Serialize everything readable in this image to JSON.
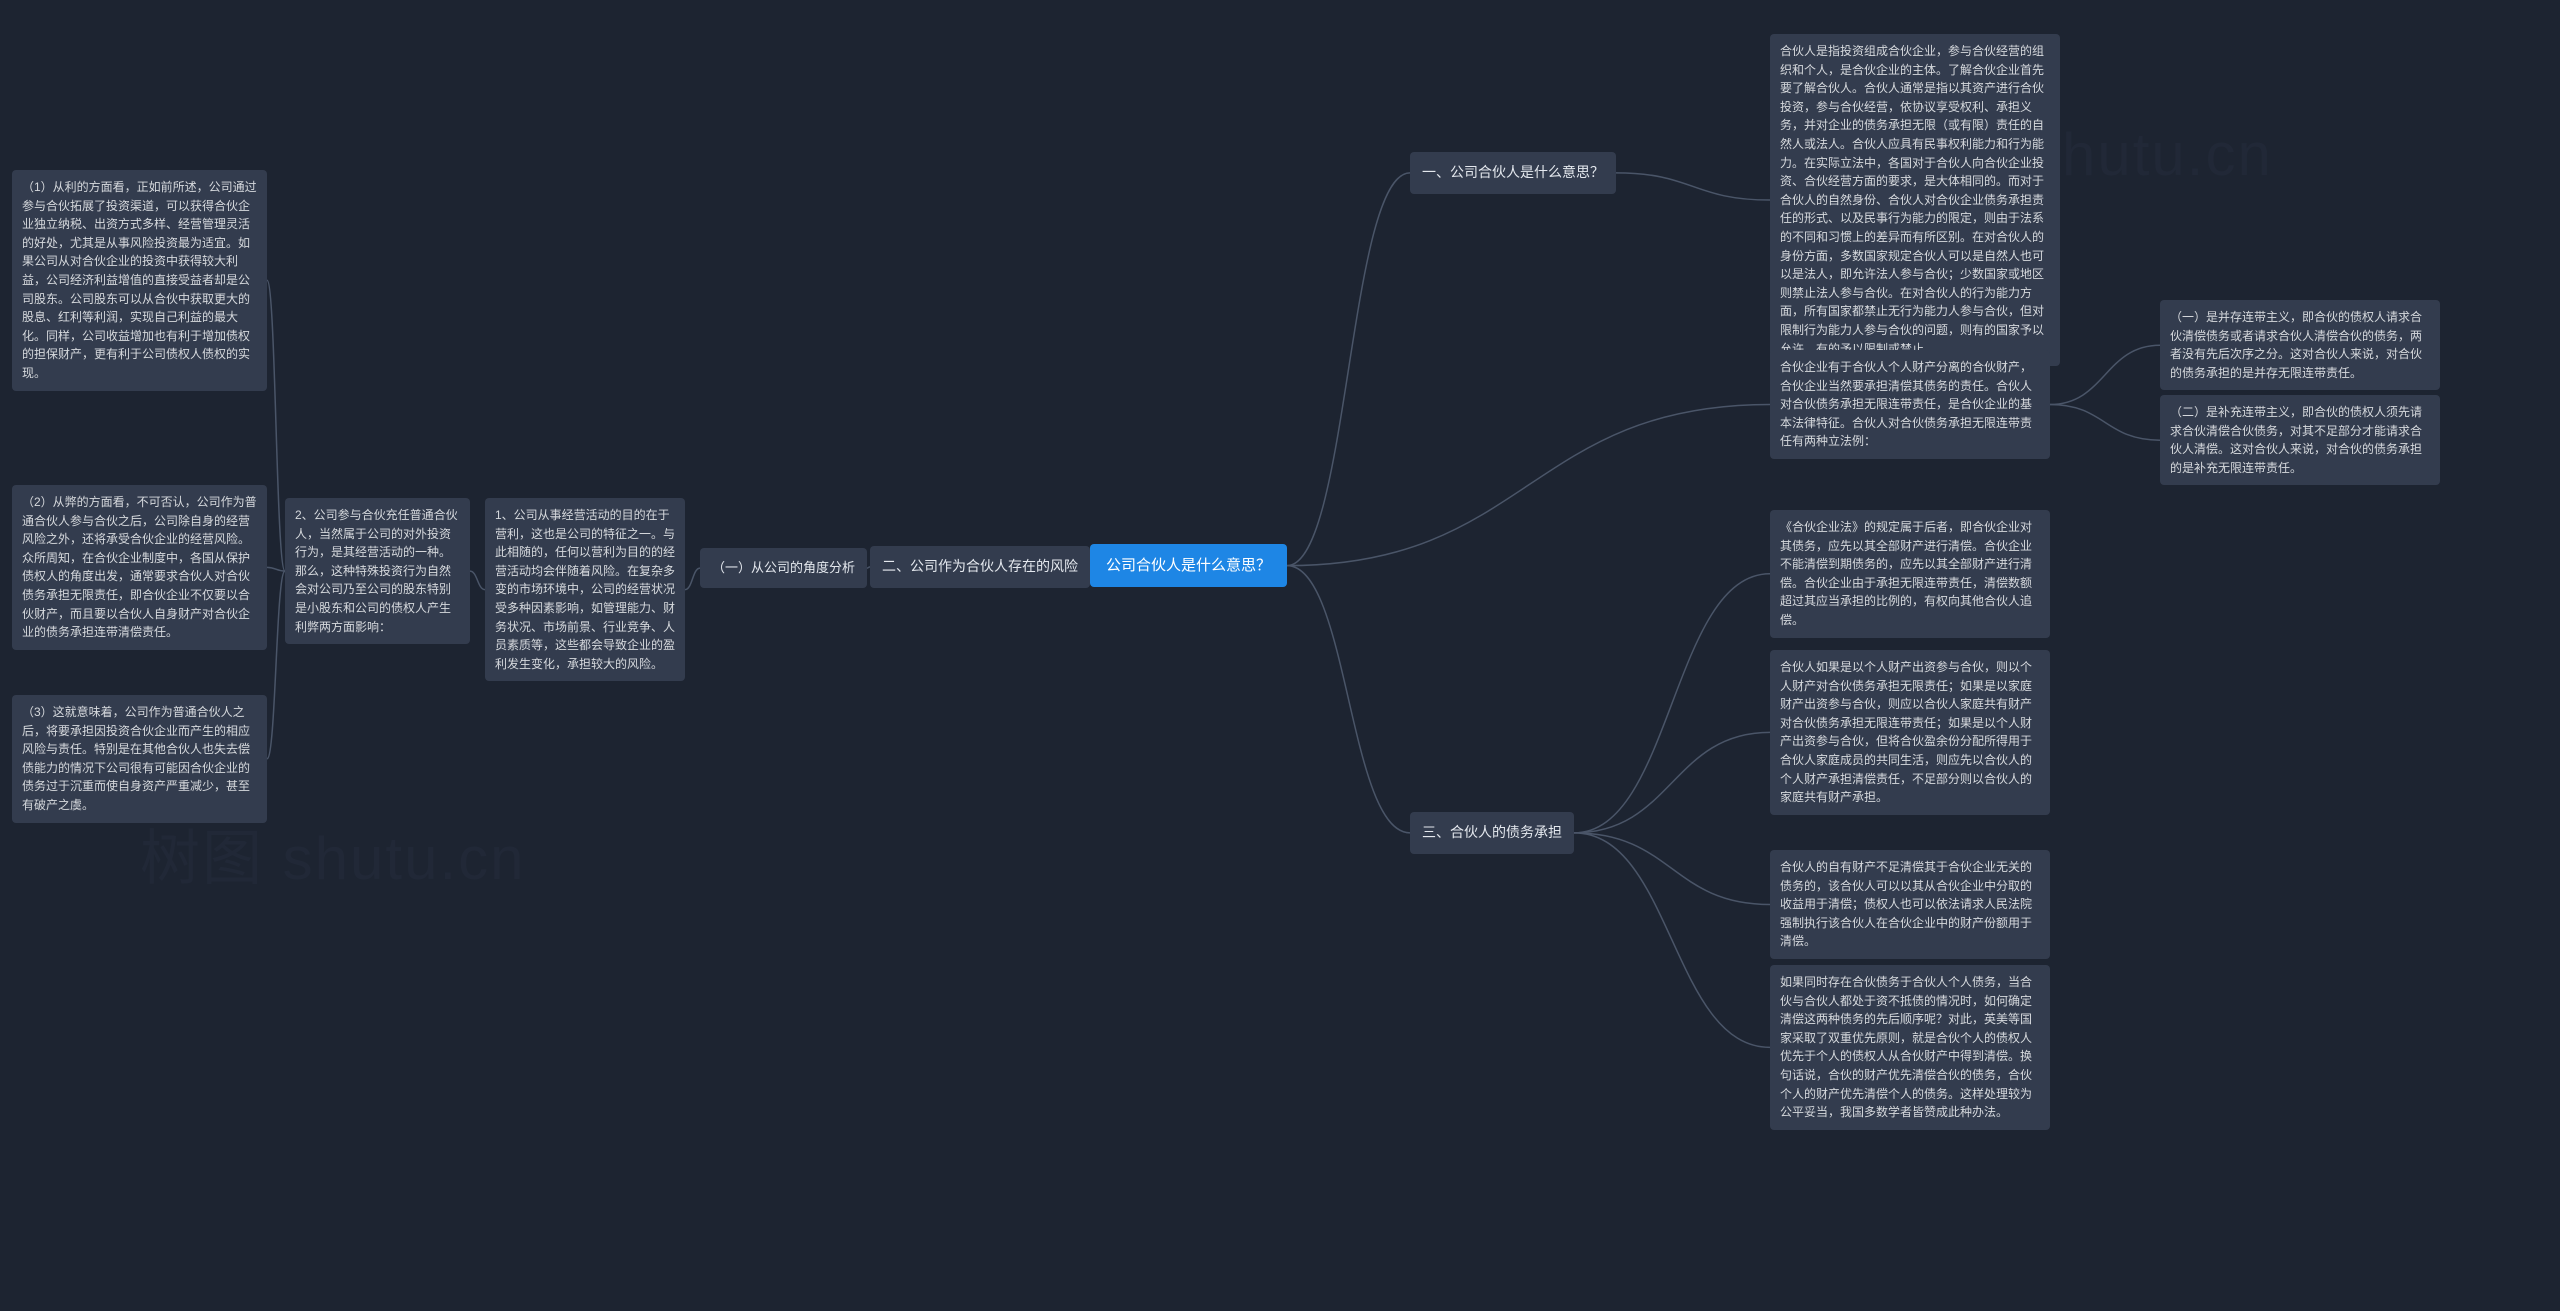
{
  "root": "公司合伙人是什么意思？",
  "watermark1": "shutu.cn",
  "watermark2": "树图 shutu.cn",
  "r1": {
    "title": "一、公司合伙人是什么意思？",
    "text": "合伙人是指投资组成合伙企业，参与合伙经营的组织和个人，是合伙企业的主体。了解合伙企业首先要了解合伙人。合伙人通常是指以其资产进行合伙投资，参与合伙经营，依协议享受权利、承担义务，并对企业的债务承担无限（或有限）责任的自然人或法人。合伙人应具有民事权利能力和行为能力。在实际立法中，各国对于合伙人向合伙企业投资、合伙经营方面的要求，是大体相同的。而对于合伙人的自然身份、合伙人对合伙企业债务承担责任的形式、以及民事行为能力的限定，则由于法系的不同和习惯上的差异而有所区别。在对合伙人的身份方面，多数国家规定合伙人可以是自然人也可以是法人，即允许法人参与合伙；少数国家或地区则禁止法人参与合伙。在对合伙人的行为能力方面，所有国家都禁止无行为能力人参与合伙，但对限制行为能力人参与合伙的问题，则有的国家予以允许，有的予以限制或禁止。"
  },
  "r2": {
    "leadin": "合伙企业有于合伙人个人财产分离的合伙财产，合伙企业当然要承担清偿其债务的责任。合伙人对合伙债务承担无限连带责任，是合伙企业的基本法律特征。合伙人对合伙债务承担无限连带责任有两种立法例：",
    "sub1": "（一）是并存连带主义，即合伙的债权人请求合伙清偿债务或者请求合伙人清偿合伙的债务，两者没有先后次序之分。这对合伙人来说，对合伙的债务承担的是并存无限连带责任。",
    "sub2": "（二）是补充连带主义，即合伙的债权人须先请求合伙清偿合伙债务，对其不足部分才能请求合伙人清偿。这对合伙人来说，对合伙的债务承担的是补充无限连带责任。"
  },
  "r3": {
    "title": "三、合伙人的债务承担",
    "p1": "《合伙企业法》的规定属于后者，即合伙企业对其债务，应先以其全部财产进行清偿。合伙企业不能清偿到期债务的，应先以其全部财产进行清偿。合伙企业由于承担无限连带责任，清偿数额超过其应当承担的比例的，有权向其他合伙人追偿。",
    "p2": "合伙人如果是以个人财产出资参与合伙，则以个人财产对合伙债务承担无限责任；如果是以家庭财产出资参与合伙，则应以合伙人家庭共有财产对合伙债务承担无限连带责任；如果是以个人财产出资参与合伙，但将合伙盈余份分配所得用于合伙人家庭成员的共同生活，则应先以合伙人的个人财产承担清偿责任，不足部分则以合伙人的家庭共有财产承担。",
    "p3": "合伙人的自有财产不足清偿其于合伙企业无关的债务的，该合伙人可以以其从合伙企业中分取的收益用于清偿；债权人也可以依法请求人民法院强制执行该合伙人在合伙企业中的财产份额用于清偿。",
    "p4": "如果同时存在合伙债务于合伙人个人债务，当合伙与合伙人都处于资不抵债的情况时，如何确定清偿这两种债务的先后顺序呢？对此，英美等国家采取了双重优先原则，就是合伙个人的债权人优先于个人的债权人从合伙财产中得到清偿。换句话说，合伙的财产优先清偿合伙的债务，合伙个人的财产优先清偿个人的债务。这样处理较为公平妥当，我国多数学者皆赞成此种办法。"
  },
  "l1": {
    "title": "二、公司作为合伙人存在的风险",
    "sub_title": "（一）从公司的角度分析",
    "g1": "1、公司从事经营活动的目的在于营利，这也是公司的特征之一。与此相随的，任何以营利为目的的经营活动均会伴随着风险。在复杂多变的市场环境中，公司的经营状况受多种因素影响，如管理能力、财务状况、市场前景、行业竞争、人员素质等，这些都会导致企业的盈利发生变化，承担较大的风险。",
    "g2": "2、公司参与合伙充任普通合伙人，当然属于公司的对外投资行为，是其经营活动的一种。那么，这种特殊投资行为自然会对公司乃至公司的股东特别是小股东和公司的债权人产生利弊两方面影响：",
    "leaf1": "（1）从利的方面看，正如前所述，公司通过参与合伙拓展了投资渠道，可以获得合伙企业独立纳税、出资方式多样、经营管理灵活的好处，尤其是从事风险投资最为适宜。如果公司从对合伙企业的投资中获得较大利益，公司经济利益增值的直接受益者却是公司股东。公司股东可以从合伙中获取更大的股息、红利等利润，实现自己利益的最大化。同样，公司收益增加也有利于增加债权的担保财产，更有利于公司债权人债权的实现。",
    "leaf2": "（2）从弊的方面看，不可否认，公司作为普通合伙人参与合伙之后，公司除自身的经营风险之外，还将承受合伙企业的经营风险。众所周知，在合伙企业制度中，各国从保护债权人的角度出发，通常要求合伙人对合伙债务承担无限责任，即合伙企业不仅要以合伙财产，而且要以合伙人自身财产对合伙企业的债务承担连带清偿责任。",
    "leaf3": "（3）这就意味着，公司作为普通合伙人之后，将要承担因投资合伙企业而产生的相应风险与责任。特别是在其他合伙人也失去偿债能力的情况下公司很有可能因合伙企业的债务过于沉重而使自身资产严重减少，甚至有破产之虞。"
  }
}
